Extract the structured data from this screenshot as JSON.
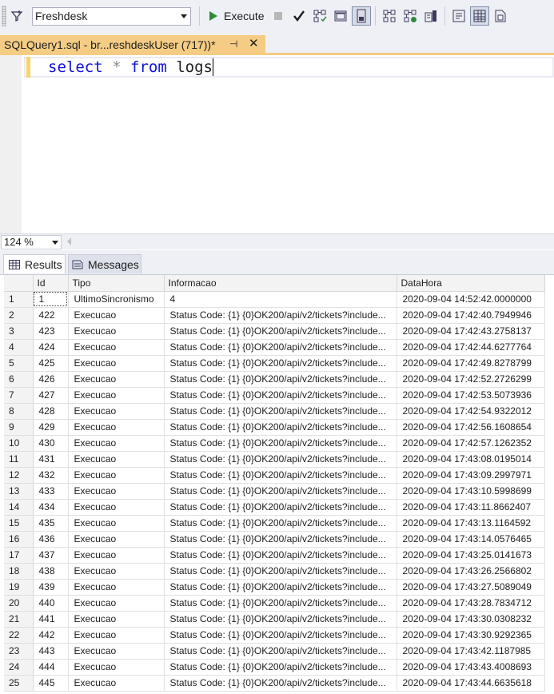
{
  "toolbar": {
    "database": "Freshdesk",
    "execute_label": "Execute",
    "icons": [
      "filter-icon",
      "stop-icon",
      "parse-check-icon",
      "display-plan-icon",
      "query-options-icon",
      "results-to-file-icon",
      "include-plan-icon",
      "live-stats-icon",
      "client-stats-icon",
      "results-to-text-icon",
      "results-to-grid-icon",
      "results-to-file-icon-2"
    ]
  },
  "document_tab": {
    "title": "SQLQuery1.sql - br...reshdeskUser (717))*",
    "pin_glyph": "⊣",
    "close_glyph": "✕"
  },
  "editor": {
    "keyword_select": "select",
    "operator_star": "*",
    "keyword_from": "from",
    "table_name": "logs"
  },
  "zoom": {
    "value": "124 %"
  },
  "result_tabs": {
    "results_label": "Results",
    "messages_label": "Messages"
  },
  "grid": {
    "columns": [
      "Id",
      "Tipo",
      "Informacao",
      "DataHora"
    ],
    "rows": [
      {
        "rn": "1",
        "id": "1",
        "tipo": "UltimoSincronismo",
        "info": "4",
        "datahora": "2020-09-04 14:52:42.0000000"
      },
      {
        "rn": "2",
        "id": "422",
        "tipo": "Execucao",
        "info": "Status Code: {1} {0}OK200/api/v2/tickets?include...",
        "datahora": "2020-09-04 17:42:40.7949946"
      },
      {
        "rn": "3",
        "id": "423",
        "tipo": "Execucao",
        "info": "Status Code: {1} {0}OK200/api/v2/tickets?include...",
        "datahora": "2020-09-04 17:42:43.2758137"
      },
      {
        "rn": "4",
        "id": "424",
        "tipo": "Execucao",
        "info": "Status Code: {1} {0}OK200/api/v2/tickets?include...",
        "datahora": "2020-09-04 17:42:44.6277764"
      },
      {
        "rn": "5",
        "id": "425",
        "tipo": "Execucao",
        "info": "Status Code: {1} {0}OK200/api/v2/tickets?include...",
        "datahora": "2020-09-04 17:42:49.8278799"
      },
      {
        "rn": "6",
        "id": "426",
        "tipo": "Execucao",
        "info": "Status Code: {1} {0}OK200/api/v2/tickets?include...",
        "datahora": "2020-09-04 17:42:52.2726299"
      },
      {
        "rn": "7",
        "id": "427",
        "tipo": "Execucao",
        "info": "Status Code: {1} {0}OK200/api/v2/tickets?include...",
        "datahora": "2020-09-04 17:42:53.5073936"
      },
      {
        "rn": "8",
        "id": "428",
        "tipo": "Execucao",
        "info": "Status Code: {1} {0}OK200/api/v2/tickets?include...",
        "datahora": "2020-09-04 17:42:54.9322012"
      },
      {
        "rn": "9",
        "id": "429",
        "tipo": "Execucao",
        "info": "Status Code: {1} {0}OK200/api/v2/tickets?include...",
        "datahora": "2020-09-04 17:42:56.1608654"
      },
      {
        "rn": "10",
        "id": "430",
        "tipo": "Execucao",
        "info": "Status Code: {1} {0}OK200/api/v2/tickets?include...",
        "datahora": "2020-09-04 17:42:57.1262352"
      },
      {
        "rn": "11",
        "id": "431",
        "tipo": "Execucao",
        "info": "Status Code: {1} {0}OK200/api/v2/tickets?include...",
        "datahora": "2020-09-04 17:43:08.0195014"
      },
      {
        "rn": "12",
        "id": "432",
        "tipo": "Execucao",
        "info": "Status Code: {1} {0}OK200/api/v2/tickets?include...",
        "datahora": "2020-09-04 17:43:09.2997971"
      },
      {
        "rn": "13",
        "id": "433",
        "tipo": "Execucao",
        "info": "Status Code: {1} {0}OK200/api/v2/tickets?include...",
        "datahora": "2020-09-04 17:43:10.5998699"
      },
      {
        "rn": "14",
        "id": "434",
        "tipo": "Execucao",
        "info": "Status Code: {1} {0}OK200/api/v2/tickets?include...",
        "datahora": "2020-09-04 17:43:11.8662407"
      },
      {
        "rn": "15",
        "id": "435",
        "tipo": "Execucao",
        "info": "Status Code: {1} {0}OK200/api/v2/tickets?include...",
        "datahora": "2020-09-04 17:43:13.1164592"
      },
      {
        "rn": "16",
        "id": "436",
        "tipo": "Execucao",
        "info": "Status Code: {1} {0}OK200/api/v2/tickets?include...",
        "datahora": "2020-09-04 17:43:14.0576465"
      },
      {
        "rn": "17",
        "id": "437",
        "tipo": "Execucao",
        "info": "Status Code: {1} {0}OK200/api/v2/tickets?include...",
        "datahora": "2020-09-04 17:43:25.0141673"
      },
      {
        "rn": "18",
        "id": "438",
        "tipo": "Execucao",
        "info": "Status Code: {1} {0}OK200/api/v2/tickets?include...",
        "datahora": "2020-09-04 17:43:26.2566802"
      },
      {
        "rn": "19",
        "id": "439",
        "tipo": "Execucao",
        "info": "Status Code: {1} {0}OK200/api/v2/tickets?include...",
        "datahora": "2020-09-04 17:43:27.5089049"
      },
      {
        "rn": "20",
        "id": "440",
        "tipo": "Execucao",
        "info": "Status Code: {1} {0}OK200/api/v2/tickets?include...",
        "datahora": "2020-09-04 17:43:28.7834712"
      },
      {
        "rn": "21",
        "id": "441",
        "tipo": "Execucao",
        "info": "Status Code: {1} {0}OK200/api/v2/tickets?include...",
        "datahora": "2020-09-04 17:43:30.0308232"
      },
      {
        "rn": "22",
        "id": "442",
        "tipo": "Execucao",
        "info": "Status Code: {1} {0}OK200/api/v2/tickets?include...",
        "datahora": "2020-09-04 17:43:30.9292365"
      },
      {
        "rn": "23",
        "id": "443",
        "tipo": "Execucao",
        "info": "Status Code: {1} {0}OK200/api/v2/tickets?include...",
        "datahora": "2020-09-04 17:43:42.1187985"
      },
      {
        "rn": "24",
        "id": "444",
        "tipo": "Execucao",
        "info": "Status Code: {1} {0}OK200/api/v2/tickets?include...",
        "datahora": "2020-09-04 17:43:43.4008693"
      },
      {
        "rn": "25",
        "id": "445",
        "tipo": "Execucao",
        "info": "Status Code: {1} {0}OK200/api/v2/tickets?include...",
        "datahora": "2020-09-04 17:43:44.6635618"
      }
    ]
  },
  "colors": {
    "tab_accent": "#f5cc84",
    "keyword": "#1010d8",
    "execute_green": "#2f8a3a"
  }
}
